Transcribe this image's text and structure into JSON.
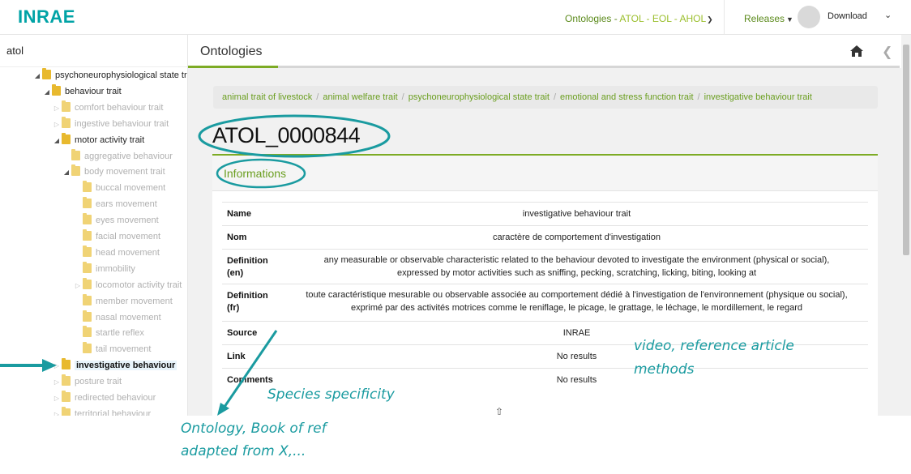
{
  "topbar": {
    "logo": "INRAE",
    "ontologies_label": "Ontologies",
    "ontologies_sep": " - ",
    "ontologies_items": [
      "ATOL",
      "EOL",
      "AHOL"
    ],
    "releases_label": "Releases",
    "download_label": "Download"
  },
  "sidebar": {
    "search_value": "atol",
    "tree": [
      {
        "label": "psychoneurophysiological state trait",
        "level": 0,
        "state": "open",
        "style": "dark"
      },
      {
        "label": "behaviour trait",
        "level": 1,
        "state": "open",
        "style": "dark"
      },
      {
        "label": "comfort behaviour trait",
        "level": 2,
        "state": "closed",
        "style": "grey"
      },
      {
        "label": "ingestive behaviour trait",
        "level": 2,
        "state": "closed",
        "style": "grey"
      },
      {
        "label": "motor activity trait",
        "level": 2,
        "state": "open",
        "style": "dark"
      },
      {
        "label": "aggregative behaviour",
        "level": 3,
        "state": "leaf",
        "style": "grey"
      },
      {
        "label": "body movement trait",
        "level": 3,
        "state": "open",
        "style": "grey"
      },
      {
        "label": "buccal movement",
        "level": 4,
        "state": "leaf",
        "style": "grey"
      },
      {
        "label": "ears movement",
        "level": 4,
        "state": "leaf",
        "style": "grey"
      },
      {
        "label": "eyes movement",
        "level": 4,
        "state": "leaf",
        "style": "grey"
      },
      {
        "label": "facial movement",
        "level": 4,
        "state": "leaf",
        "style": "grey"
      },
      {
        "label": "head movement",
        "level": 4,
        "state": "leaf",
        "style": "grey"
      },
      {
        "label": "immobility",
        "level": 4,
        "state": "leaf",
        "style": "grey"
      },
      {
        "label": "locomotor activity trait",
        "level": 4,
        "state": "closed",
        "style": "grey"
      },
      {
        "label": "member movement",
        "level": 4,
        "state": "leaf",
        "style": "grey"
      },
      {
        "label": "nasal movement",
        "level": 4,
        "state": "leaf",
        "style": "grey"
      },
      {
        "label": "startle reflex",
        "level": 4,
        "state": "leaf",
        "style": "grey"
      },
      {
        "label": "tail movement",
        "level": 4,
        "state": "leaf",
        "style": "grey"
      },
      {
        "label": "investigative behaviour",
        "level": 2,
        "state": "closed",
        "style": "selected"
      },
      {
        "label": "posture trait",
        "level": 2,
        "state": "closed",
        "style": "grey"
      },
      {
        "label": "redirected behaviour",
        "level": 2,
        "state": "closed",
        "style": "grey"
      },
      {
        "label": "territorial behaviour",
        "level": 2,
        "state": "closed",
        "style": "grey"
      }
    ]
  },
  "main": {
    "title": "Ontologies",
    "breadcrumb": [
      "animal trait of livestock",
      "animal welfare trait",
      "psychoneurophysiological state trait",
      "emotional and stress function trait",
      "investigative behaviour trait"
    ],
    "breadcrumb_sep": "/",
    "ontology_id": "ATOL_0000844",
    "panel_title": "Informations",
    "info": [
      {
        "key": [
          "Name"
        ],
        "value": [
          "investigative behaviour trait"
        ]
      },
      {
        "key": [
          "Nom"
        ],
        "value": [
          "caractère de comportement d'investigation"
        ]
      },
      {
        "key": [
          "Definition",
          "(en)"
        ],
        "value": [
          "any measurable or observable characteristic related to the behaviour devoted to investigate the environment (physical or social),",
          "expressed by motor activities such as sniffing, pecking, scratching, licking, biting, looking at"
        ]
      },
      {
        "key": [
          "Definition",
          "(fr)"
        ],
        "value": [
          "toute caractéristique mesurable ou observable associée au comportement dédié à l'investigation de l'environnement (physique ou social),",
          "exprimé par des activités motrices comme le reniflage, le picage, le grattage, le léchage, le mordillement, le regard"
        ]
      },
      {
        "key": [
          "Source"
        ],
        "value": [
          "INRAE"
        ]
      },
      {
        "key": [
          "Link"
        ],
        "value": [
          "No results"
        ]
      },
      {
        "key": [
          "Comments"
        ],
        "value": [
          "No results"
        ]
      }
    ]
  },
  "annotations": {
    "video_ref": "video, reference article",
    "methods": "methods",
    "species": "Species specificity",
    "onto_book": "Ontology, Book of ref",
    "adapted": "adapted from X,..."
  },
  "colors": {
    "accent_green": "#7dab25",
    "link_green": "#6a9e1f",
    "logo_teal": "#00a3a6",
    "annotation_teal": "#1a9ba0"
  },
  "icons": [
    "home-icon",
    "chevron-left-icon",
    "chevron-down-icon",
    "folder-icon",
    "tree-toggle-icon",
    "mouse-cursor-icon"
  ]
}
